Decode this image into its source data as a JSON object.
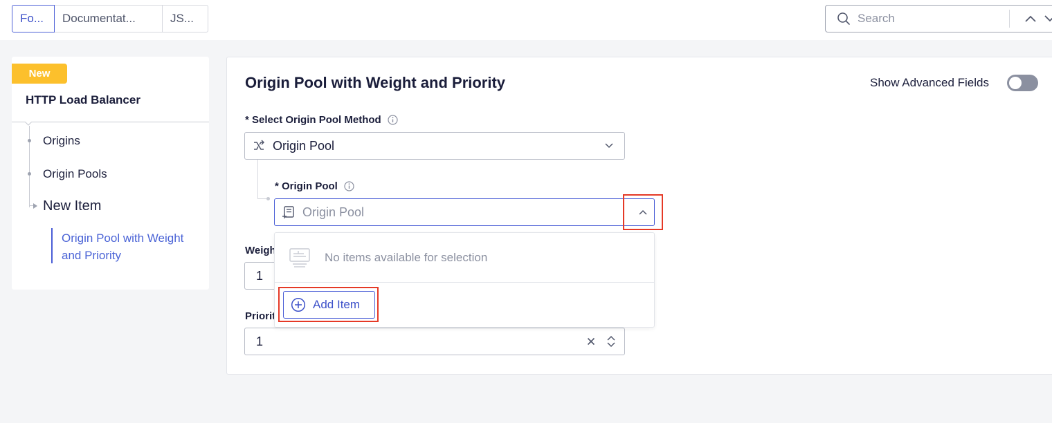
{
  "tabs": [
    {
      "label": "Fo...",
      "active": true
    },
    {
      "label": "Documentat...",
      "active": false
    },
    {
      "label": "JS...",
      "active": false
    }
  ],
  "search": {
    "placeholder": "Search"
  },
  "sidebar": {
    "badge": "New",
    "title": "HTTP Load Balancer",
    "items": [
      {
        "label": "Origins"
      },
      {
        "label": "Origin Pools"
      },
      {
        "label": "New Item"
      }
    ],
    "sub_item": "Origin Pool with Weight and Priority"
  },
  "form": {
    "title": "Origin Pool with Weight and Priority",
    "advanced_label": "Show Advanced Fields",
    "advanced_on": false,
    "method_label": "* Select Origin Pool Method",
    "method_value": "Origin Pool",
    "pool_label": "* Origin Pool",
    "pool_placeholder": "Origin Pool",
    "weight_label": "Weigh",
    "weight_value": "1",
    "priority_label": "Priorit",
    "priority_value": "1"
  },
  "dropdown": {
    "empty_text": "No items available for selection",
    "add_label": "Add Item"
  },
  "colors": {
    "accent": "#4a5ed6",
    "badge": "#fcc02c",
    "highlight": "#e53926"
  },
  "icons": [
    "search-icon",
    "chevron-up-icon",
    "chevron-down-icon",
    "info-icon",
    "route-icon",
    "list-add-icon",
    "empty-list-icon",
    "plus-circle-icon",
    "clear-icon"
  ]
}
